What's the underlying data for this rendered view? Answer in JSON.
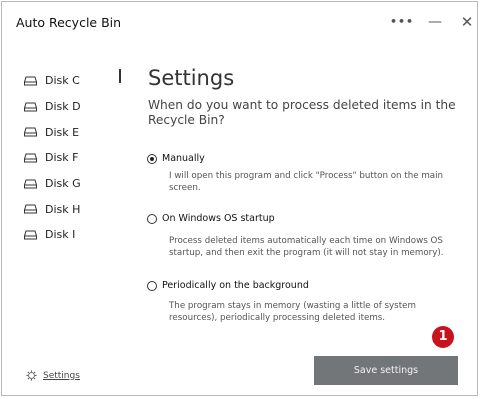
{
  "window": {
    "title": "Auto Recycle Bin",
    "controls": {
      "more": "•••",
      "minimize": "—",
      "close": "✕"
    }
  },
  "sidebar": {
    "disks": [
      "Disk C",
      "Disk D",
      "Disk E",
      "Disk F",
      "Disk G",
      "Disk H",
      "Disk I"
    ],
    "settings_link": "Settings"
  },
  "main": {
    "heading": "Settings",
    "question": "When do you want to process deleted items in the Recycle Bin?",
    "options": [
      {
        "label": "Manually",
        "selected": true,
        "description": "I will open this program and click \"Process\" button on the main screen."
      },
      {
        "label": "On Windows OS startup",
        "selected": false,
        "description": "Process deleted items automatically each time on Windows OS startup, and then exit the program (it will not stay in memory)."
      },
      {
        "label": "Periodically on the background",
        "selected": false,
        "description": "The program stays in memory (wasting a little of system resources), periodically processing deleted items."
      }
    ],
    "annotation_badge": "1",
    "save_button": "Save settings"
  },
  "colors": {
    "accent_badge": "#c7141c",
    "button_bg": "#737679"
  },
  "icons": {
    "disk": "drive-icon",
    "settings": "gear-icon"
  }
}
